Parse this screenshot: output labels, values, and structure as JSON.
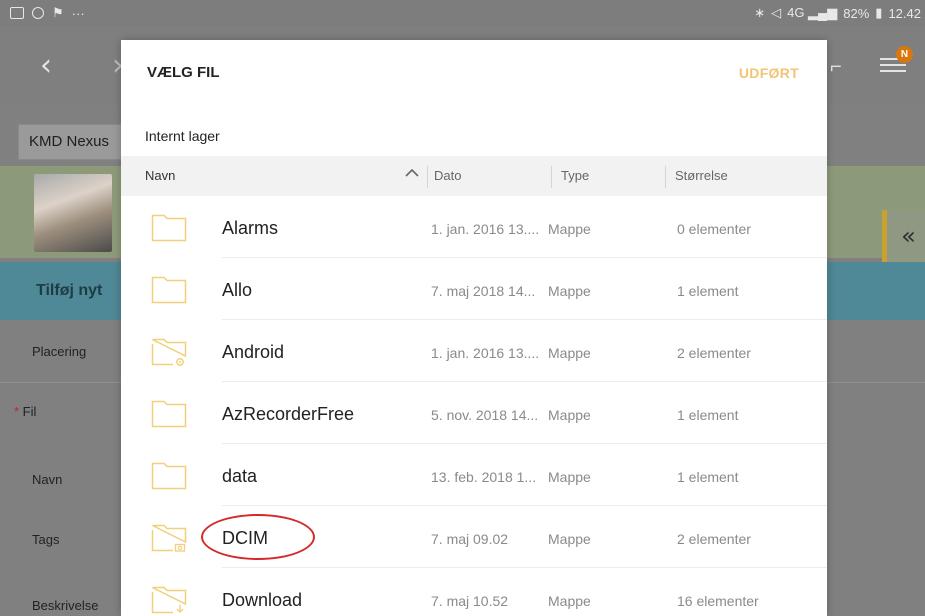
{
  "statusbar": {
    "battery": "82%",
    "time": "12.42",
    "signal": "4G"
  },
  "background": {
    "tab_label": "KMD Nexus",
    "section_title": "Tilføj nyt",
    "rows": [
      {
        "label": "Placering",
        "required": false
      },
      {
        "label": "Fil",
        "required": true
      },
      {
        "label": "Navn",
        "required": false
      },
      {
        "label": "Tags",
        "required": false
      },
      {
        "label": "Beskrivelse",
        "required": false
      }
    ],
    "notification_badge": "N",
    "collapse_glyph": "«"
  },
  "dialog": {
    "title": "VÆLG FIL",
    "done_label": "UDFØRT",
    "breadcrumb": "Internt lager",
    "columns": {
      "name": "Navn",
      "date": "Dato",
      "type": "Type",
      "size": "Størrelse"
    },
    "files": [
      {
        "name": "Alarms",
        "date": "1. jan. 2016 13....",
        "type": "Mappe",
        "size": "0 elementer",
        "icon": "folder-icon"
      },
      {
        "name": "Allo",
        "date": "7. maj 2018 14...",
        "type": "Mappe",
        "size": "1 element",
        "icon": "folder-icon"
      },
      {
        "name": "Android",
        "date": "1. jan. 2016 13....",
        "type": "Mappe",
        "size": "2 elementer",
        "icon": "folder-settings-icon"
      },
      {
        "name": "AzRecorderFree",
        "date": "5. nov. 2018 14...",
        "type": "Mappe",
        "size": "1 element",
        "icon": "folder-icon"
      },
      {
        "name": "data",
        "date": "13. feb. 2018 1...",
        "type": "Mappe",
        "size": "1 element",
        "icon": "folder-icon"
      },
      {
        "name": "DCIM",
        "date": "7. maj 09.02",
        "type": "Mappe",
        "size": "2 elementer",
        "icon": "folder-camera-icon"
      },
      {
        "name": "Download",
        "date": "7. maj 10.52",
        "type": "Mappe",
        "size": "16 elementer",
        "icon": "folder-download-icon"
      }
    ]
  },
  "colors": {
    "folder_stroke": "#f2cf7a",
    "accent_done": "#f2c476",
    "highlight_circle": "#d42a2a",
    "section_bg": "#4f8896"
  }
}
